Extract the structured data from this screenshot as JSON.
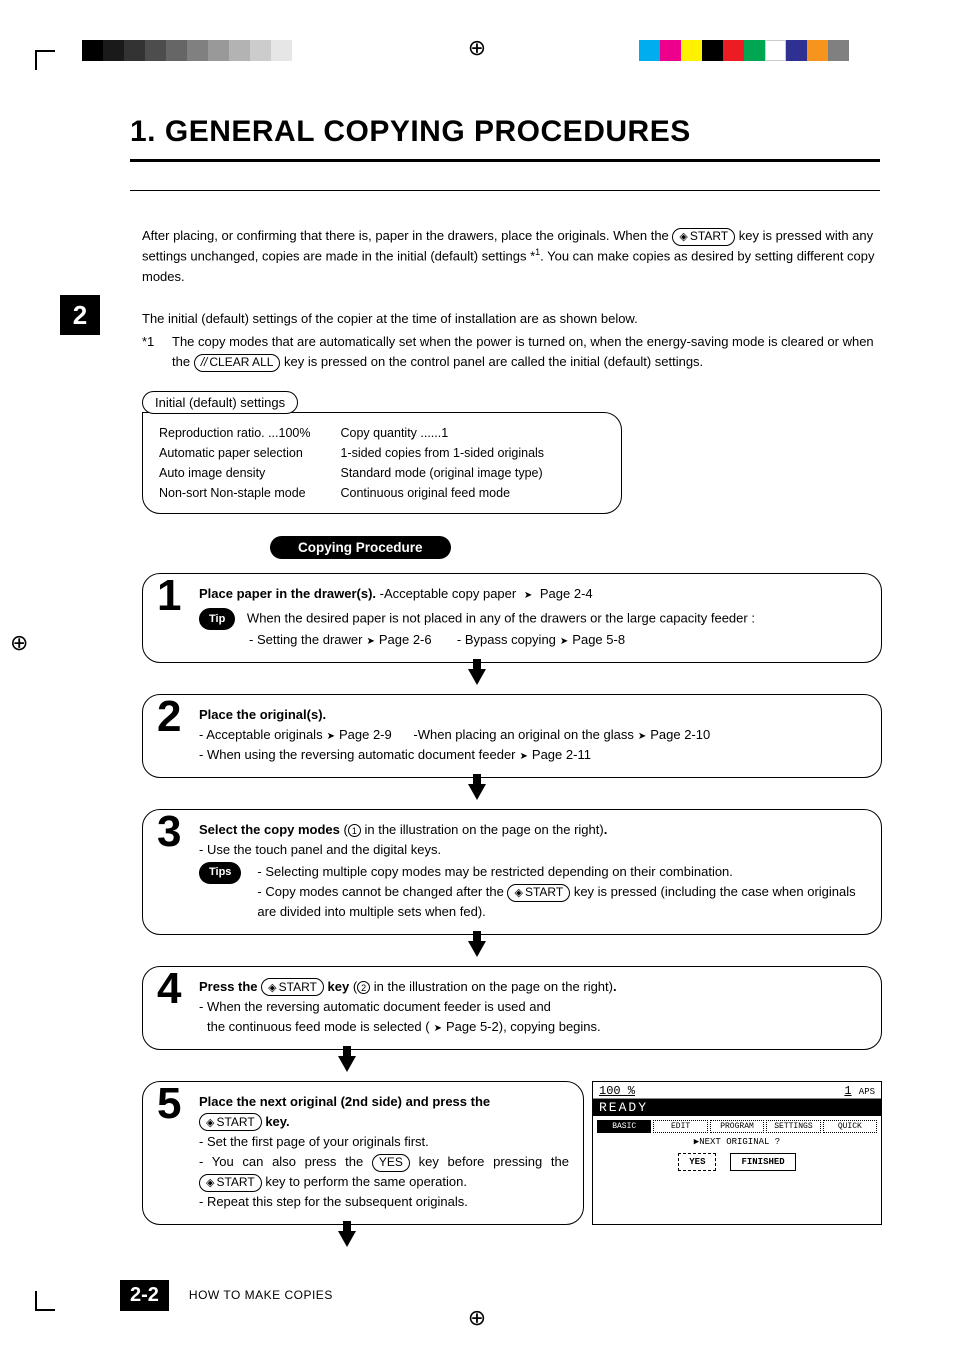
{
  "title": "1. GENERAL COPYING PROCEDURES",
  "chapter_tab": "2",
  "intro_part1": "After placing, or confirming that there is, paper in the drawers,  place the originals.  When the",
  "start_key": "START",
  "intro_part2": "key is pressed with any settings unchanged, copies are made in the initial (default) settings *",
  "intro_part3": ".  You can make copies as desired by setting different copy modes.",
  "initial_line1": "The initial (default) settings of the copier at the time of installation are as shown below.",
  "initial_ast_label": "*1",
  "initial_ast_text1": "The copy modes that are automatically set when the power is turned on, when the energy-saving mode is cleared or when the",
  "clear_all_key": "CLEAR ALL",
  "initial_ast_text2": "key is pressed on the control panel are called the initial (default) settings.",
  "settings_tab": "Initial (default) settings",
  "settings_col1": {
    "a": "Reproduction ratio. ...100%",
    "b": "Automatic paper selection",
    "c": "Auto image density",
    "d": "Non-sort Non-staple mode"
  },
  "settings_col2": {
    "a": "Copy quantity ......1",
    "b": "1-sided copies from 1-sided originals",
    "c": "Standard mode (original image type)",
    "d": "Continuous original feed mode"
  },
  "section_heading": "Copying Procedure",
  "step1": {
    "num": "1",
    "head": "Place paper in the drawer(s).",
    "head_note": "-Acceptable copy paper",
    "head_page": "Page 2-4",
    "tip": "Tip",
    "tiptext": "When the desired paper is not placed in any of the drawers or the large capacity feeder :",
    "sub1": "- Setting the drawer",
    "sub1p": "Page 2-6",
    "sub2": "- Bypass copying",
    "sub2p": "Page 5-8"
  },
  "step2": {
    "num": "2",
    "head": "Place the original(s).",
    "l1a": "- Acceptable originals",
    "l1ap": "Page 2-9",
    "l1b": "-When placing an original on the glass",
    "l1bp": "Page 2-10",
    "l2": "- When using the reversing automatic document feeder",
    "l2p": "Page 2-11"
  },
  "step3": {
    "num": "3",
    "head": "Select the copy modes",
    "head_note1": "(",
    "head_note2": " in the illustration on the page on the right)",
    "sub": "- Use the touch panel and the digital keys.",
    "tips": "Tips",
    "t1": "- Selecting multiple copy modes may be restricted depending on their combination.",
    "t2a": "- Copy modes cannot be changed after the",
    "t2b": "key is pressed (including the case when originals are divided into multiple sets when fed)."
  },
  "step4": {
    "num": "4",
    "head1": "Press the",
    "head2": "key",
    "head_note": " in the illustration on the page on the right)",
    "l1": "- When the reversing automatic document feeder is used and",
    "l2a": "the continuous feed mode is selected (",
    "l2p": "Page 5-2",
    "l2b": "), copying begins."
  },
  "step5": {
    "num": "5",
    "head": "Place the next original (2nd side) and press the",
    "head2": "key.",
    "l1": "- Set the first page of your originals first.",
    "l2a": "- You can also press the",
    "yes": "YES",
    "l2b": "key before pressing the",
    "l2c": "key to perform the same operation.",
    "l3": "- Repeat this step for the subsequent originals."
  },
  "lcd": {
    "pct": "100 %",
    "qty": "1",
    "aps": "APS",
    "ready": "READY",
    "tabs": [
      "BASIC",
      "EDIT",
      "PROGRAM",
      "SETTINGS",
      "QUICK"
    ],
    "question": "▶NEXT ORIGINAL ?",
    "btn_yes": "YES",
    "btn_fin": "FINISHED"
  },
  "footer_page": "2-2",
  "footer_text": "HOW TO MAKE COPIES",
  "reg_colors_left": [
    "#000",
    "#222",
    "#333",
    "#555",
    "#777",
    "#999",
    "#bbb",
    "#ccc",
    "#ddd",
    "#fff"
  ],
  "reg_colors_right": [
    "#00aeef",
    "#ec008c",
    "#fff200",
    "#000",
    "#ed1c24",
    "#00a651",
    "#999",
    "#2e3192",
    "#f7941e",
    "#666"
  ]
}
